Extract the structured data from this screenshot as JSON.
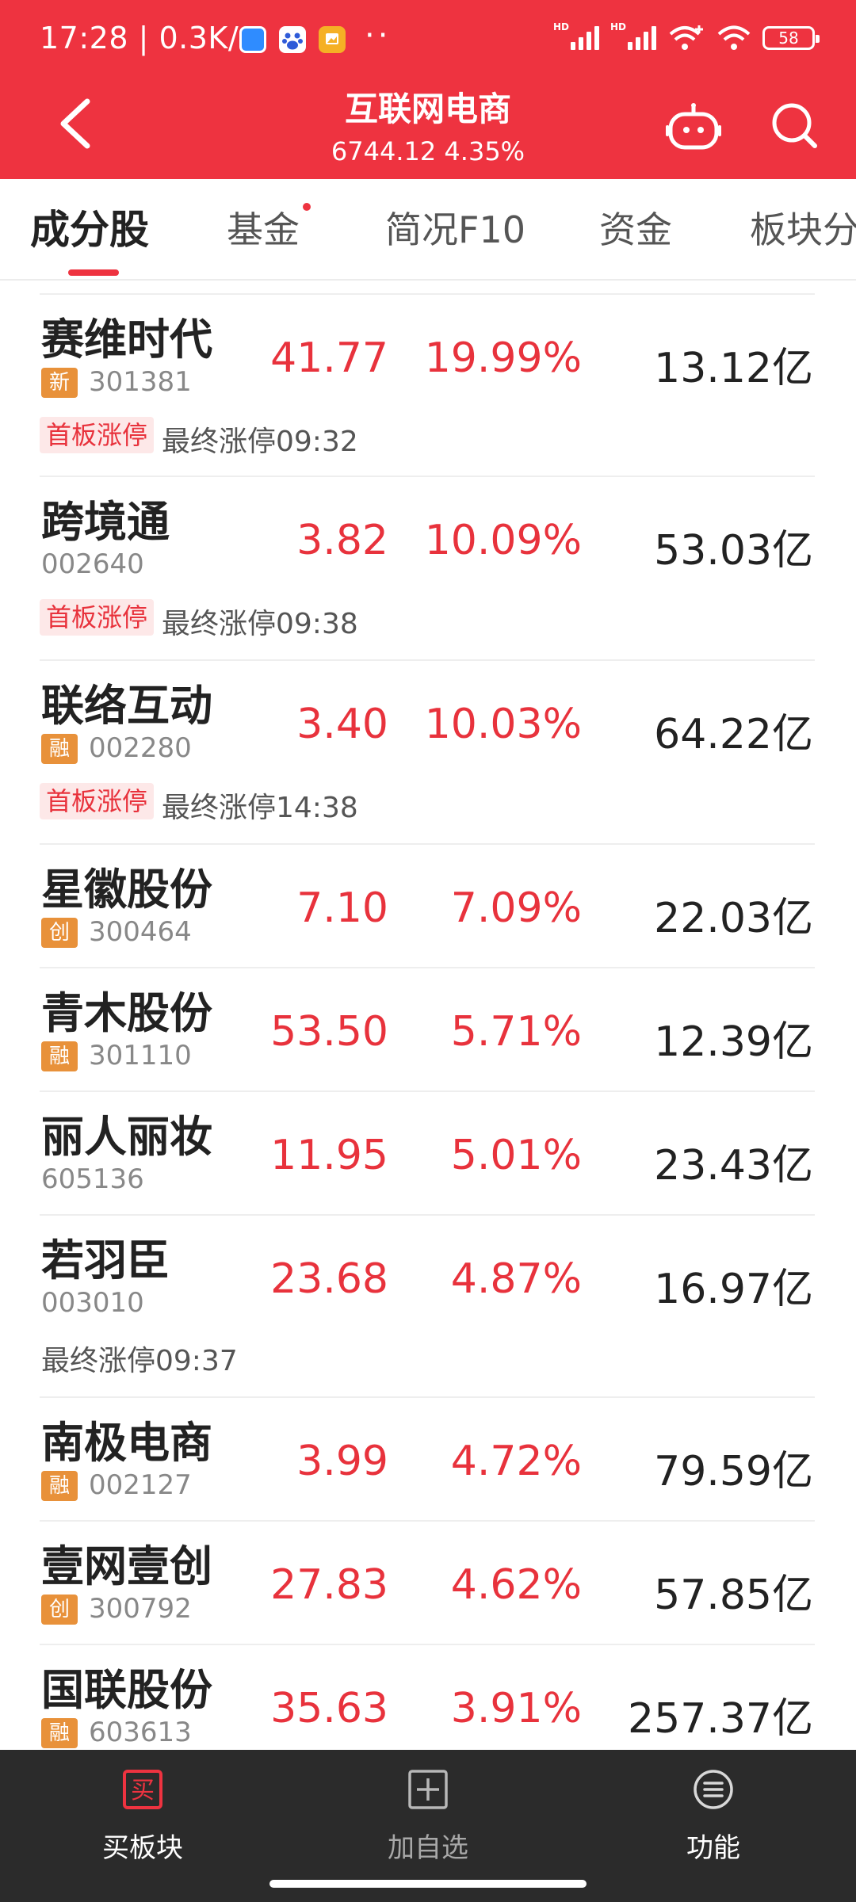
{
  "status_bar": {
    "time": "17:28 | 0.3K/s",
    "dots": "··",
    "hd": "HD",
    "battery": "58"
  },
  "header": {
    "title": "互联网电商",
    "index_value": "6744.12 4.35%"
  },
  "tabs": [
    {
      "label": "成分股"
    },
    {
      "label": "基金"
    },
    {
      "label": "简况F10"
    },
    {
      "label": "资金"
    },
    {
      "label": "板块分"
    }
  ],
  "stocks": [
    {
      "name": "赛维时代",
      "badge": "新",
      "code": "301381",
      "price": "41.77",
      "change": "19.99%",
      "market_cap": "13.12亿",
      "tag": "首板涨停",
      "note": "最终涨停09:32"
    },
    {
      "name": "跨境通",
      "badge": "",
      "code": "002640",
      "price": "3.82",
      "change": "10.09%",
      "market_cap": "53.03亿",
      "tag": "首板涨停",
      "note": "最终涨停09:38"
    },
    {
      "name": "联络互动",
      "badge": "融",
      "code": "002280",
      "price": "3.40",
      "change": "10.03%",
      "market_cap": "64.22亿",
      "tag": "首板涨停",
      "note": "最终涨停14:38"
    },
    {
      "name": "星徽股份",
      "badge": "创",
      "code": "300464",
      "price": "7.10",
      "change": "7.09%",
      "market_cap": "22.03亿",
      "tag": "",
      "note": ""
    },
    {
      "name": "青木股份",
      "badge": "融",
      "code": "301110",
      "price": "53.50",
      "change": "5.71%",
      "market_cap": "12.39亿",
      "tag": "",
      "note": ""
    },
    {
      "name": "丽人丽妆",
      "badge": "",
      "code": "605136",
      "price": "11.95",
      "change": "5.01%",
      "market_cap": "23.43亿",
      "tag": "",
      "note": ""
    },
    {
      "name": "若羽臣",
      "badge": "",
      "code": "003010",
      "price": "23.68",
      "change": "4.87%",
      "market_cap": "16.97亿",
      "tag": "",
      "note": "最终涨停09:37"
    },
    {
      "name": "南极电商",
      "badge": "融",
      "code": "002127",
      "price": "3.99",
      "change": "4.72%",
      "market_cap": "79.59亿",
      "tag": "",
      "note": ""
    },
    {
      "name": "壹网壹创",
      "badge": "创",
      "code": "300792",
      "price": "27.83",
      "change": "4.62%",
      "market_cap": "57.85亿",
      "tag": "",
      "note": ""
    },
    {
      "name": "国联股份",
      "badge": "融",
      "code": "603613",
      "price": "35.63",
      "change": "3.91%",
      "market_cap": "257.37亿",
      "tag": "",
      "note": ""
    }
  ],
  "bottom_nav": {
    "buy_icon_glyph": "买",
    "items": [
      {
        "label": "买板块"
      },
      {
        "label": "加自选"
      },
      {
        "label": "功能"
      }
    ]
  },
  "colors": {
    "brand_red": "#ee3340",
    "up_red": "#e8323c",
    "badge_orange": "#e8913a"
  }
}
